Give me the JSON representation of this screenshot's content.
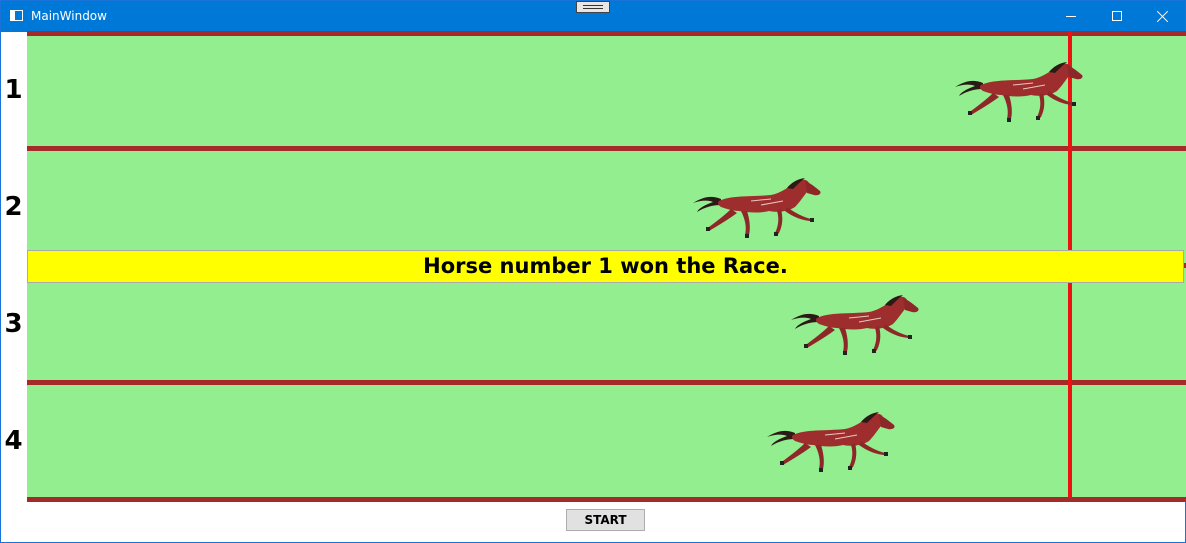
{
  "window": {
    "title": "MainWindow"
  },
  "lanes": [
    {
      "number": "1"
    },
    {
      "number": "2"
    },
    {
      "number": "3"
    },
    {
      "number": "4"
    }
  ],
  "result_message": "Horse number 1 won the Race.",
  "start_button_label": "START",
  "icons": [
    "app-icon",
    "minimize-icon",
    "maximize-icon",
    "close-icon",
    "horse-icon"
  ],
  "colors": {
    "titlebar": "#0078d7",
    "track": "#93ee8f",
    "rail": "#a52a2a",
    "finish_line": "#ee1111",
    "banner": "#ffff00",
    "horse": "#9e2e2e"
  }
}
